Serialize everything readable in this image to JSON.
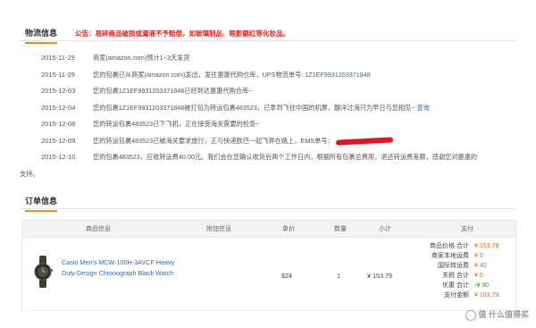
{
  "logistics": {
    "title": "物流信息",
    "notice": "公告：易碎商品破损或漏液不予赔偿，如玻璃制品、眼影腮红等化妆品。",
    "entries": [
      {
        "date": "2015-11-29",
        "text": "商家(amazon.com)预计1~3天发货"
      },
      {
        "date": "2015-11-29",
        "text": "您的包裹已从商家(amazon.com)发出，发往惠惠代购仓库，UPS物流单号: ",
        "link": "1Z1EF9931203371848"
      },
      {
        "date": "2015-12-03",
        "text": "您的包裹1Z1EF9931203371848已经到达惠惠代购仓库~"
      },
      {
        "date": "2015-12-04",
        "text": "您的包裹1Z1EF9931203371848被打包为转运包裹483523，已拿到飞往中国的机票，翻洋过海只为早日与您相见~ ",
        "link": "查询"
      },
      {
        "date": "2015-12-08",
        "text": "您的转运包裹483523已下飞机，正在接受海关需要的检查~"
      },
      {
        "date": "2015-12-09",
        "text": "您的转运包裹483523已被海关要求放行，正与快递欧巴一起飞奔在路上，EMS单号："
      },
      {
        "date": "2015-12-10",
        "text": "您的包裹483523，应收转运费40.00元。我们会在您确认收货后两个工作日内，根据所有包裹总费用，退还转运费差额，感谢您对惠惠的",
        "cont": "支持。"
      }
    ]
  },
  "order": {
    "title": "订单信息",
    "columns": [
      "商品信息",
      "附加信息",
      "单价",
      "数量",
      "小计",
      "支付"
    ],
    "item": {
      "name": "Casio Men's MCW-100H-3AVCF Heavy Duty-Design Chronograph Black Watch",
      "unit_price": "$24",
      "quantity": "1",
      "subtotal": "¥ 153.79"
    },
    "payment": [
      {
        "label": "商品价格 合计",
        "value": "¥ 153.79"
      },
      {
        "label": "商家本地运费",
        "value": "¥ 0"
      },
      {
        "label": "国际转运费",
        "value": "¥ 40"
      },
      {
        "label": "关税 合计",
        "value": "¥ 0"
      },
      {
        "label": "优惠 合计",
        "value": "-¥ 30",
        "color": "green"
      },
      {
        "label": "支付金额",
        "value": "¥ 163.79"
      }
    ]
  },
  "watermark": "值 什么值得买"
}
